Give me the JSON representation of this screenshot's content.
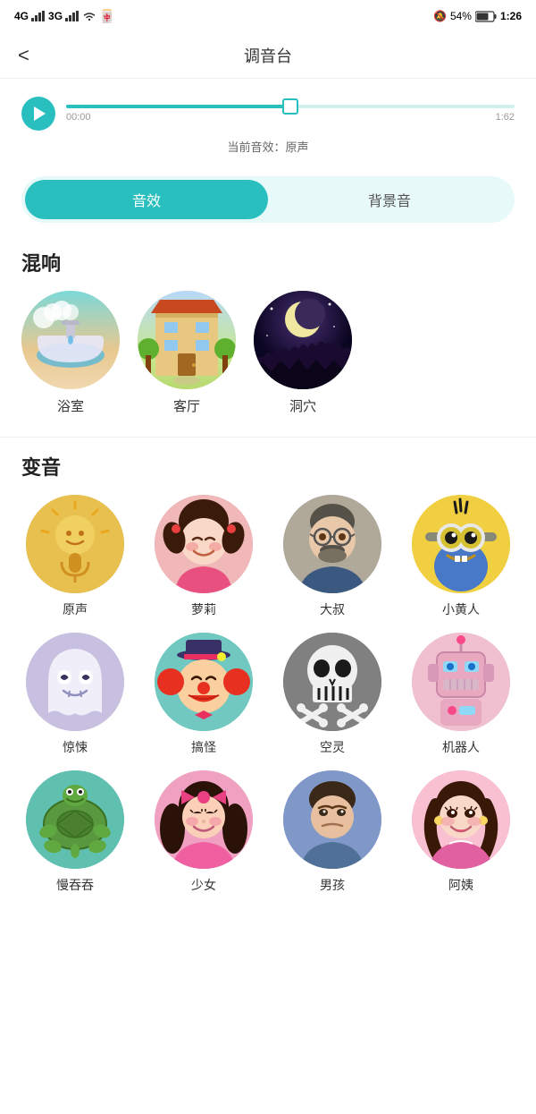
{
  "statusBar": {
    "leftText": "4G  .il  3G  .il",
    "wifi": "WiFi",
    "time": "1:26",
    "battery": "54%"
  },
  "header": {
    "back": "<",
    "title": "调音台"
  },
  "player": {
    "timeStart": "00:00",
    "timeEnd": "1:62",
    "effectLabel": "当前音效：原声",
    "progressPercent": 50
  },
  "tabs": {
    "active": "音效",
    "inactive": "背景音"
  },
  "reverb": {
    "sectionTitle": "混响",
    "items": [
      {
        "id": "bathroom",
        "label": "浴室"
      },
      {
        "id": "livingroom",
        "label": "客厅"
      },
      {
        "id": "cave",
        "label": "洞穴"
      }
    ]
  },
  "voiceChange": {
    "sectionTitle": "变音",
    "items": [
      {
        "id": "original",
        "label": "原声"
      },
      {
        "id": "molly",
        "label": "萝莉"
      },
      {
        "id": "uncle",
        "label": "大叔"
      },
      {
        "id": "minion",
        "label": "小黄人"
      },
      {
        "id": "ghost",
        "label": "惊悚"
      },
      {
        "id": "clown",
        "label": "搞怪"
      },
      {
        "id": "spirit",
        "label": "空灵"
      },
      {
        "id": "robot",
        "label": "机器人"
      },
      {
        "id": "slow",
        "label": "慢吞吞"
      },
      {
        "id": "girl",
        "label": "少女"
      },
      {
        "id": "boy",
        "label": "男孩"
      },
      {
        "id": "auntie",
        "label": "阿姨"
      }
    ]
  }
}
